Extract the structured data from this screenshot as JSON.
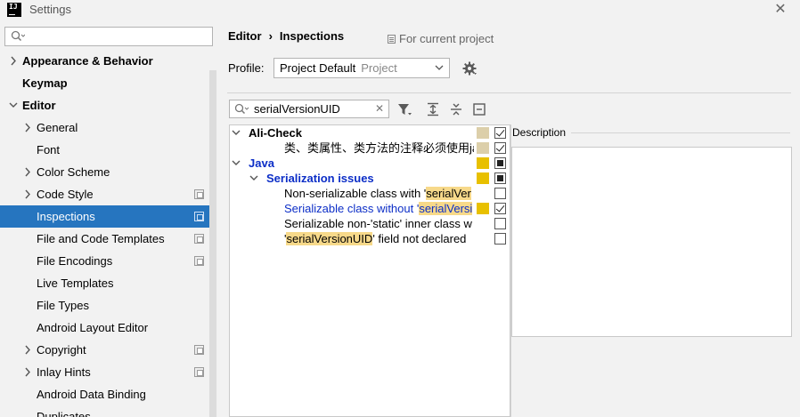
{
  "window": {
    "title": "Settings",
    "app_icon_text": "IJ"
  },
  "sidebar": {
    "search": {
      "value": "",
      "placeholder": ""
    },
    "items": [
      {
        "label": "Appearance & Behavior",
        "level": 0,
        "expandable": true,
        "expanded": false,
        "bold": true
      },
      {
        "label": "Keymap",
        "level": 0,
        "expandable": false,
        "bold": true
      },
      {
        "label": "Editor",
        "level": 0,
        "expandable": true,
        "expanded": true,
        "bold": true
      },
      {
        "label": "General",
        "level": 1,
        "expandable": true,
        "expanded": false
      },
      {
        "label": "Font",
        "level": 1,
        "expandable": false
      },
      {
        "label": "Color Scheme",
        "level": 1,
        "expandable": true,
        "expanded": false
      },
      {
        "label": "Code Style",
        "level": 1,
        "expandable": true,
        "expanded": false,
        "scope_icon": true
      },
      {
        "label": "Inspections",
        "level": 1,
        "expandable": false,
        "selected": true,
        "scope_icon": true
      },
      {
        "label": "File and Code Templates",
        "level": 1,
        "expandable": false,
        "scope_icon": true
      },
      {
        "label": "File Encodings",
        "level": 1,
        "expandable": false,
        "scope_icon": true
      },
      {
        "label": "Live Templates",
        "level": 1,
        "expandable": false
      },
      {
        "label": "File Types",
        "level": 1,
        "expandable": false
      },
      {
        "label": "Android Layout Editor",
        "level": 1,
        "expandable": false
      },
      {
        "label": "Copyright",
        "level": 1,
        "expandable": true,
        "expanded": false,
        "scope_icon": true
      },
      {
        "label": "Inlay Hints",
        "level": 1,
        "expandable": true,
        "expanded": false,
        "scope_icon": true
      },
      {
        "label": "Android Data Binding",
        "level": 1,
        "expandable": false
      },
      {
        "label": "Duplicates",
        "level": 1,
        "expandable": false
      }
    ]
  },
  "breadcrumb": {
    "part1": "Editor",
    "separator": "›",
    "part2": "Inspections"
  },
  "for_current_project": "For current project",
  "profile": {
    "label": "Profile:",
    "value": "Project Default",
    "scope": "Project"
  },
  "filter": {
    "value": "serialVersionUID",
    "clear_icon": "close-icon"
  },
  "inspections": [
    {
      "pre": "Ali-Check",
      "hl": "",
      "post": "",
      "style": "bold",
      "expanded": true,
      "severity_color": "#dccfaa",
      "check": "checked",
      "level": 0
    },
    {
      "pre": "类、类属性、类方法的注释必须使用javado",
      "hl": "",
      "post": "",
      "style": "normal",
      "severity_color": "#dccfaa",
      "check": "checked",
      "level": 2
    },
    {
      "pre": "Java",
      "hl": "",
      "post": "",
      "style": "bold-blue",
      "expanded": true,
      "severity_color": "#e8c000",
      "check": "partial",
      "level": 0
    },
    {
      "pre": "Serialization issues",
      "hl": "",
      "post": "",
      "style": "bold-blue",
      "expanded": true,
      "severity_color": "#e8c000",
      "check": "partial",
      "level": 1
    },
    {
      "pre": "Non-serializable class with '",
      "hl": "serialVer",
      "post": "",
      "style": "normal",
      "severity_color": "",
      "check": "unchecked",
      "level": 2
    },
    {
      "pre": "Serializable class without '",
      "hl": "serialVersi",
      "post": "",
      "style": "blue",
      "severity_color": "#e8c000",
      "check": "checked",
      "level": 2
    },
    {
      "pre": "Serializable non-'static' inner class w",
      "hl": "",
      "post": "",
      "style": "normal",
      "severity_color": "",
      "check": "unchecked",
      "level": 2
    },
    {
      "pre": "'",
      "hl": "serialVersionUID",
      "post": "' field not declared",
      "style": "normal",
      "severity_color": "",
      "check": "unchecked",
      "level": 2
    }
  ],
  "description": {
    "title": "Description",
    "text": ""
  }
}
